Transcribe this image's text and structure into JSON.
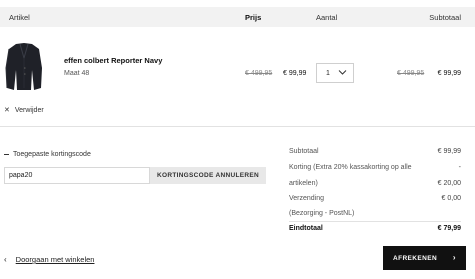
{
  "table_header": {
    "artikel": "Artikel",
    "prijs": "Prijs",
    "aantal": "Aantal",
    "subtotaal": "Subtotaal"
  },
  "product": {
    "name": "effen colbert Reporter Navy",
    "size": "Maat 48",
    "price_old": "€ 499,95",
    "price_new": "€ 99,99",
    "quantity": "1",
    "subtotal_old": "€ 499,95",
    "subtotal_new": "€ 99,99",
    "image_icon": "navy-blazer-icon",
    "image_color": "#1f2128"
  },
  "remove": {
    "icon": "close-icon",
    "label": "Verwijder"
  },
  "coupon": {
    "label": "Toegepaste kortingscode",
    "value": "papa20",
    "cancel_label": "KORTINGSCODE ANNULEREN"
  },
  "summary": {
    "subtotal_label": "Subtotaal",
    "subtotal_value": "€ 99,99",
    "discount_label_line1": "Korting (Extra 20% kassakorting op alle",
    "discount_label_line2": "artikelen)",
    "discount_dash": "-",
    "discount_value": "€ 20,00",
    "shipping_label": "Verzending",
    "shipping_value": "€ 0,00",
    "shipping_note": "(Bezorging - PostNL)",
    "total_label": "Eindtotaal",
    "total_value": "€ 79,99"
  },
  "footer": {
    "back_label": "Doorgaan met winkelen",
    "checkout_label": "AFREKENEN",
    "checkout_color": "#111111"
  }
}
